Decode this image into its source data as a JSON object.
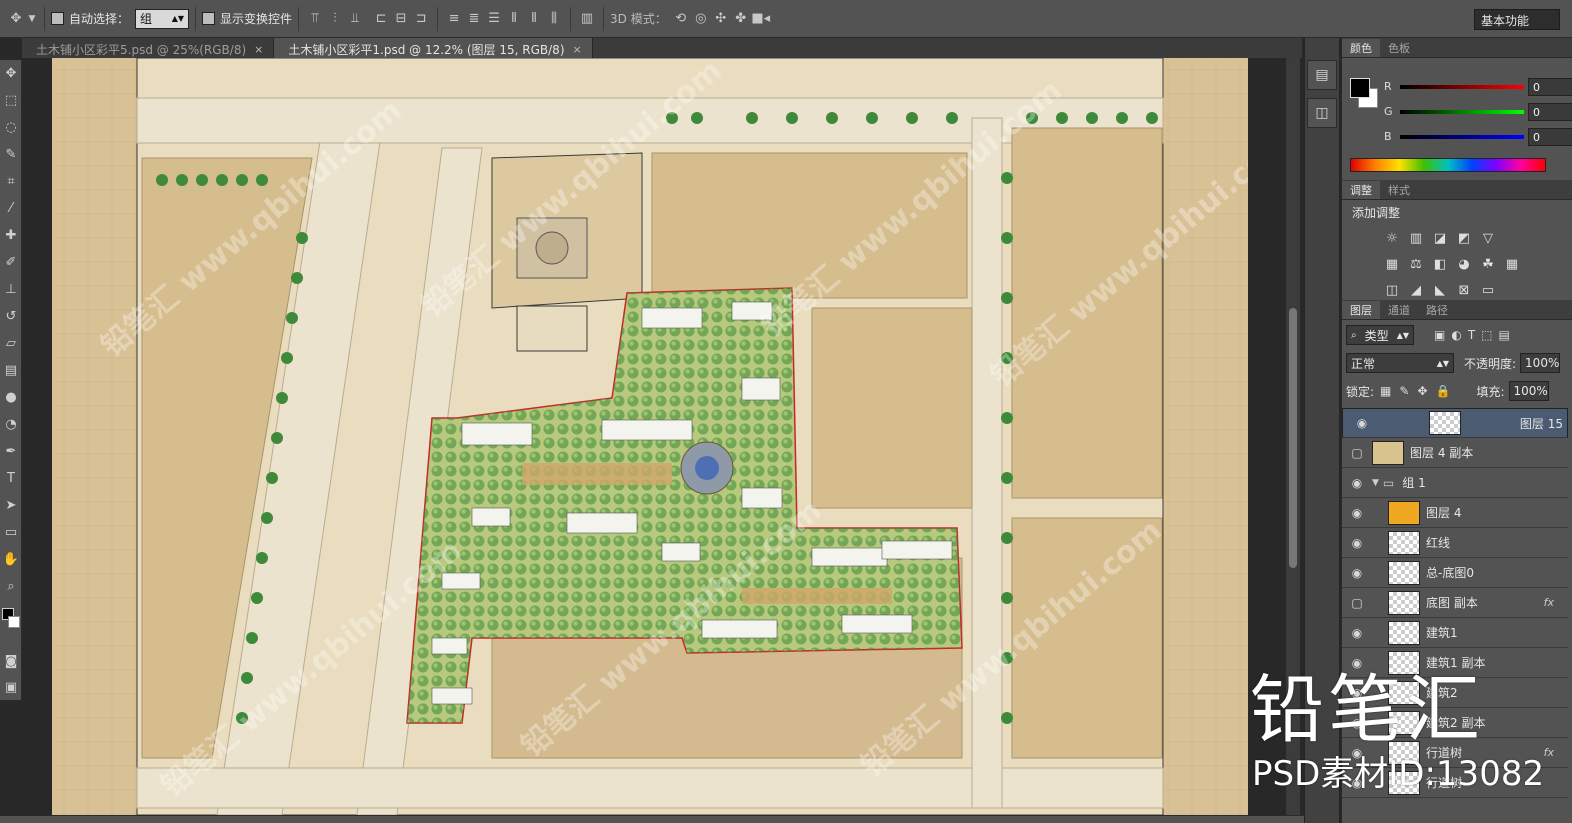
{
  "options_bar": {
    "auto_select_label": "自动选择：",
    "auto_select_value": "组",
    "show_transform_label": "显示变换控件",
    "mode_3d_label": "3D 模式：",
    "workspace": "基本功能"
  },
  "tabs": [
    {
      "label": "土木铺小区彩平5.psd @ 25%(RGB/8)",
      "close": "×"
    },
    {
      "label": "土木铺小区彩平1.psd @ 12.2% (图层 15, RGB/8)",
      "close": "×"
    }
  ],
  "color_panel": {
    "tabs": [
      "颜色",
      "色板"
    ],
    "channels": [
      {
        "name": "R",
        "value": "0",
        "gradient": "linear-gradient(to right,#000,#ff0000)"
      },
      {
        "name": "G",
        "value": "0",
        "gradient": "linear-gradient(to right,#000,#00ff00)"
      },
      {
        "name": "B",
        "value": "0",
        "gradient": "linear-gradient(to right,#000,#0000ff)"
      }
    ]
  },
  "adjust_panel": {
    "tabs": [
      "调整",
      "样式"
    ],
    "title": "添加调整"
  },
  "layers_panel": {
    "tabs": [
      "图层",
      "通道",
      "路径"
    ],
    "filter": "类型",
    "blend_mode": "正常",
    "opacity_label": "不透明度:",
    "opacity_value": "100%",
    "lock_label": "锁定:",
    "fill_label": "填充:",
    "fill_value": "100%",
    "layers": [
      {
        "name": "图层 15",
        "visible": true,
        "selected": true,
        "thumb": "checker",
        "indent": 0
      },
      {
        "name": "图层 4 副本",
        "visible": false,
        "thumb": "plan",
        "indent": 0
      },
      {
        "name": "组 1",
        "visible": true,
        "thumb": "folder",
        "indent": 0
      },
      {
        "name": "图层 4",
        "visible": true,
        "thumb": "orange",
        "indent": 1
      },
      {
        "name": "红线",
        "visible": true,
        "thumb": "checker",
        "indent": 1
      },
      {
        "name": "总-底图0",
        "visible": true,
        "thumb": "checker",
        "indent": 1
      },
      {
        "name": "底图 副本",
        "visible": false,
        "thumb": "checker",
        "indent": 1,
        "fx": "fx"
      },
      {
        "name": "建筑1",
        "visible": true,
        "thumb": "checker",
        "indent": 1
      },
      {
        "name": "建筑1 副本",
        "visible": true,
        "thumb": "checker",
        "indent": 1
      },
      {
        "name": "建筑2",
        "visible": true,
        "thumb": "checker",
        "indent": 1
      },
      {
        "name": "建筑2 副本",
        "visible": true,
        "thumb": "checker",
        "indent": 1
      },
      {
        "name": "行道树",
        "visible": true,
        "thumb": "checker",
        "indent": 1,
        "fx": "fx"
      },
      {
        "name": "行道树",
        "visible": true,
        "thumb": "checker",
        "indent": 1
      }
    ]
  },
  "watermark": {
    "title": "铅笔汇",
    "id": "PSD素材ID:13082"
  },
  "colors": {
    "panel_bg": "#535353",
    "selected_layer": "#4b5b72",
    "doc_paper": "#d8c095",
    "red_line": "#c8262b"
  }
}
